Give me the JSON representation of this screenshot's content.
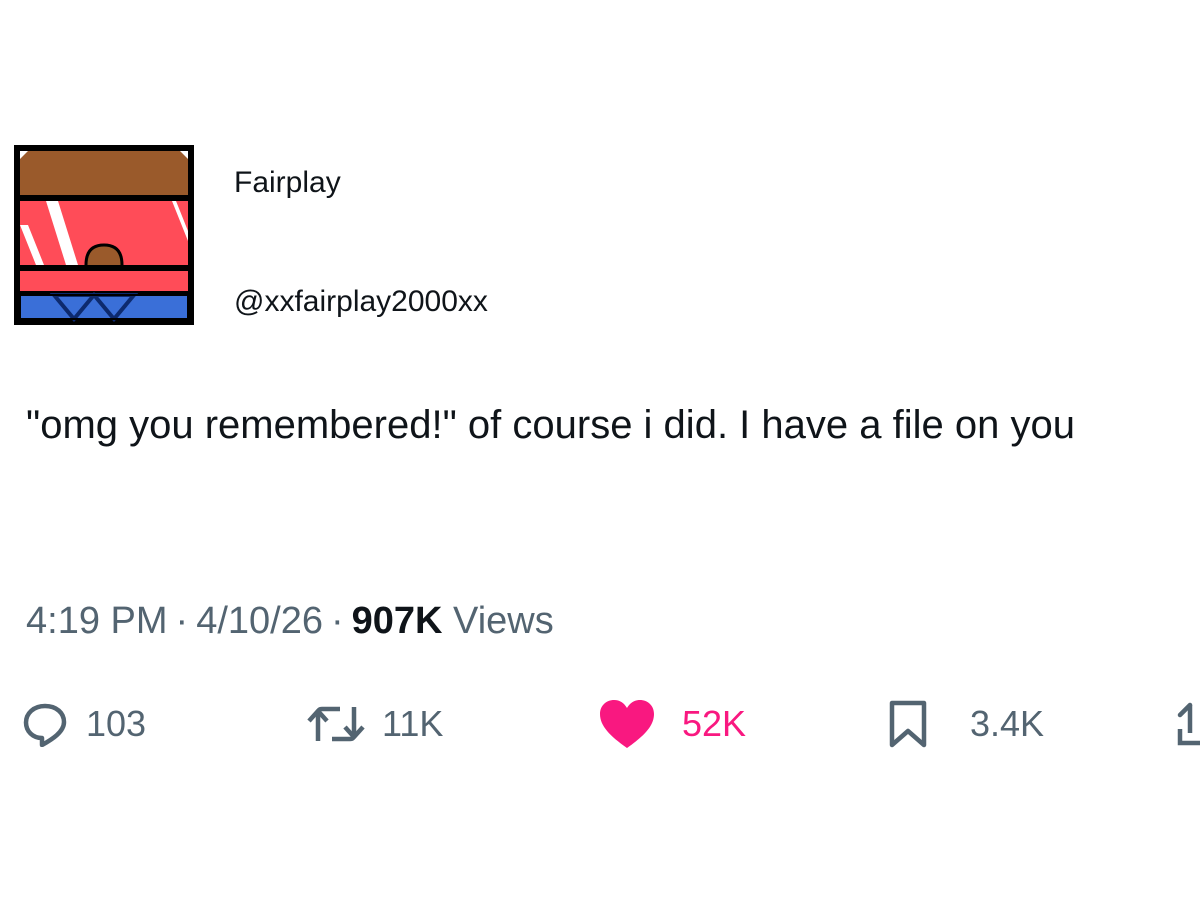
{
  "author": {
    "display_name": "Fairplay",
    "handle": "@xxfairplay2000xx",
    "avatar_icon": "pixel-art-character-avatar"
  },
  "tweet": {
    "text": "\"omg you remembered!\" of course i did. I have a file on you"
  },
  "meta": {
    "time": "4:19 PM",
    "separator": "·",
    "date": "4/10/26",
    "views_count": "907K",
    "views_label": "Views"
  },
  "actions": {
    "reply": {
      "icon": "reply-bubble-icon",
      "count": "103"
    },
    "retweet": {
      "icon": "retweet-icon",
      "count": "11K"
    },
    "like": {
      "icon": "heart-icon",
      "count": "52K",
      "active": true,
      "color": "#f91880"
    },
    "bookmark": {
      "icon": "bookmark-icon",
      "count": "3.4K"
    },
    "share": {
      "icon": "share-icon"
    }
  },
  "colors": {
    "text_primary": "#0f1419",
    "text_secondary": "#536471",
    "like_pink": "#f91880"
  }
}
